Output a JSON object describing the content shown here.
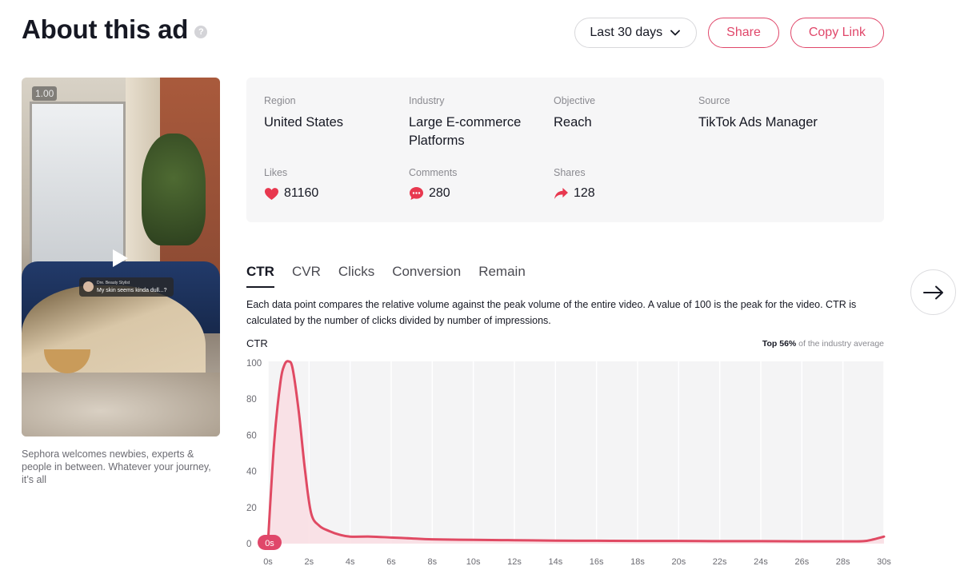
{
  "header": {
    "title": "About this ad",
    "help_icon": "?",
    "date_range": "Last 30 days",
    "share_label": "Share",
    "copy_link_label": "Copy Link"
  },
  "video": {
    "timestamp": "1.00",
    "bubble_name": "Dre. Beauty Stylist",
    "bubble_text": "My skin seems kinda dull...?",
    "description": "Sephora welcomes newbies, experts & people in between. Whatever your journey, it’s all"
  },
  "info": {
    "region_label": "Region",
    "region_value": "United States",
    "industry_label": "Industry",
    "industry_value": "Large E-commerce Platforms",
    "objective_label": "Objective",
    "objective_value": "Reach",
    "source_label": "Source",
    "source_value": "TikTok Ads Manager",
    "likes_label": "Likes",
    "likes_value": "81160",
    "comments_label": "Comments",
    "comments_value": "280",
    "shares_label": "Shares",
    "shares_value": "128"
  },
  "tabs": [
    {
      "label": "CTR",
      "active": true
    },
    {
      "label": "CVR",
      "active": false
    },
    {
      "label": "Clicks",
      "active": false
    },
    {
      "label": "Conversion",
      "active": false
    },
    {
      "label": "Remain",
      "active": false
    }
  ],
  "chart_section": {
    "description": "Each data point compares the relative volume against the peak volume of the entire video. A value of 100 is the peak for the video. CTR is calculated by the number of clicks divided by number of impressions.",
    "chart_label": "CTR",
    "industry_top": "Top 56%",
    "industry_rest": " of the industry average"
  },
  "colors": {
    "accent": "#e0476a",
    "line": "#e04a63",
    "area": "#f9dfe4"
  },
  "chart_data": {
    "type": "area",
    "title": "CTR",
    "xlabel": "",
    "ylabel": "",
    "x_ticks": [
      "0s",
      "2s",
      "4s",
      "6s",
      "8s",
      "10s",
      "12s",
      "14s",
      "16s",
      "18s",
      "20s",
      "22s",
      "24s",
      "26s",
      "28s",
      "30s"
    ],
    "y_ticks": [
      0,
      20,
      40,
      60,
      80,
      100
    ],
    "ylim": [
      0,
      100
    ],
    "xlim": [
      0,
      30
    ],
    "current_marker": "0s",
    "series": [
      {
        "x": [
          0,
          0.3,
          0.6,
          0.8,
          1.0,
          1.2,
          1.5,
          1.8,
          2.1,
          2.5,
          3.0,
          3.5,
          4.0,
          5.0,
          6.0,
          7.0,
          8.0,
          10.0,
          12.0,
          14.0,
          16.0,
          18.0,
          20.0,
          22.0,
          24.0,
          26.0,
          28.0,
          29.0,
          29.5,
          30.0
        ],
        "values": [
          0,
          55,
          88,
          98,
          100,
          96,
          72,
          40,
          16,
          9,
          6,
          4,
          3,
          3,
          2.5,
          2,
          1.5,
          1.2,
          1,
          0.8,
          0.7,
          0.6,
          0.6,
          0.5,
          0.5,
          0.4,
          0.4,
          0.5,
          1.5,
          3
        ]
      }
    ]
  }
}
